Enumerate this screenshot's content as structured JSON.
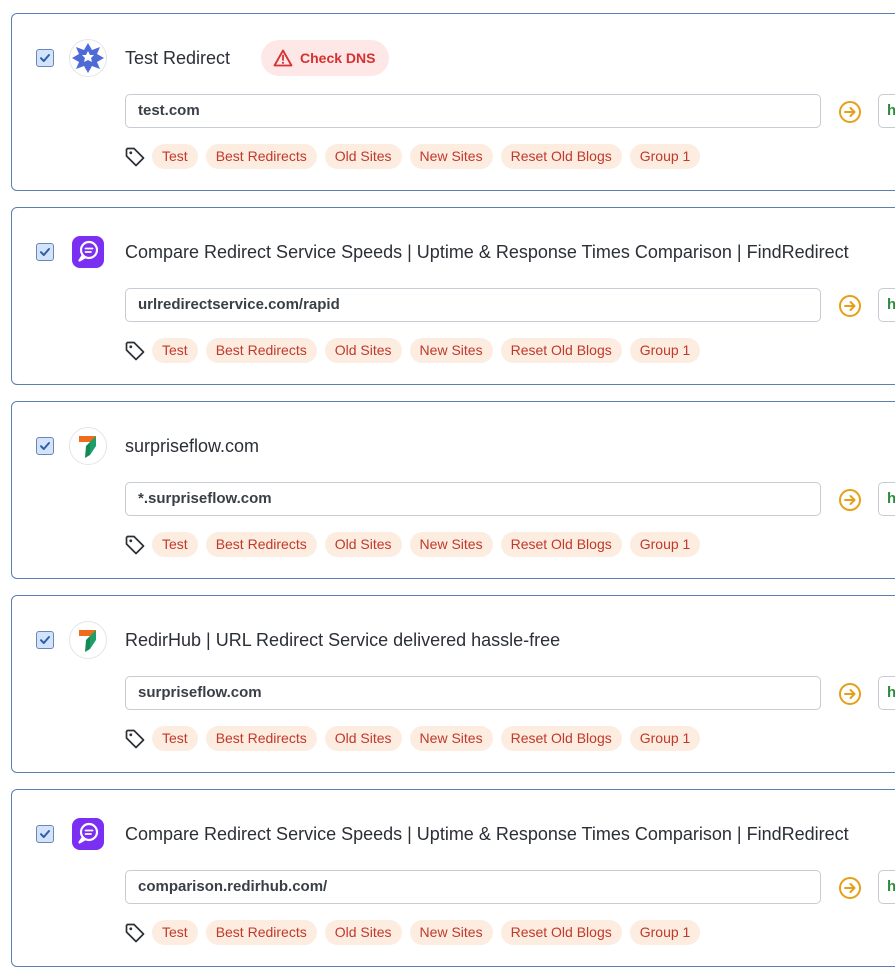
{
  "redirects": [
    {
      "title": "Test Redirect",
      "badge": "Check DNS",
      "favicon": "star-badge-icon",
      "source": "test.com",
      "dest_prefix": "h",
      "tags": [
        "Test",
        "Best Redirects",
        "Old Sites",
        "New Sites",
        "Reset Old Blogs",
        "Group 1"
      ]
    },
    {
      "title": "Compare Redirect Service Speeds | Uptime & Response Times Comparison | FindRedirect",
      "favicon": "chat-bubble-icon",
      "source": "urlredirectservice.com/rapid",
      "dest_prefix": "h",
      "tags": [
        "Test",
        "Best Redirects",
        "Old Sites",
        "New Sites",
        "Reset Old Blogs",
        "Group 1"
      ]
    },
    {
      "title": "surpriseflow.com",
      "favicon": "flow-arrow-icon",
      "source": "*.surpriseflow.com",
      "dest_prefix": "h",
      "tags": [
        "Test",
        "Best Redirects",
        "Old Sites",
        "New Sites",
        "Reset Old Blogs",
        "Group 1"
      ]
    },
    {
      "title": "RedirHub | URL Redirect Service delivered hassle-free",
      "favicon": "flow-arrow-icon",
      "source": "surpriseflow.com",
      "dest_prefix": "h",
      "tags": [
        "Test",
        "Best Redirects",
        "Old Sites",
        "New Sites",
        "Reset Old Blogs",
        "Group 1"
      ]
    },
    {
      "title": "Compare Redirect Service Speeds | Uptime & Response Times Comparison | FindRedirect",
      "favicon": "chat-bubble-icon",
      "source": "comparison.redirhub.com/",
      "dest_prefix": "h",
      "tags": [
        "Test",
        "Best Redirects",
        "Old Sites",
        "New Sites",
        "Reset Old Blogs",
        "Group 1"
      ]
    }
  ],
  "colors": {
    "card_border": "#5b7fae",
    "checkbox_bg": "#d3e3fb",
    "checkbox_check": "#2f5fa7",
    "tag_bg": "#fdece0",
    "tag_text": "#c0392b",
    "arrow": "#e6a017",
    "badge_bg": "#fde7e7",
    "badge_text": "#d63031",
    "dest_text": "#2e8b3e"
  }
}
